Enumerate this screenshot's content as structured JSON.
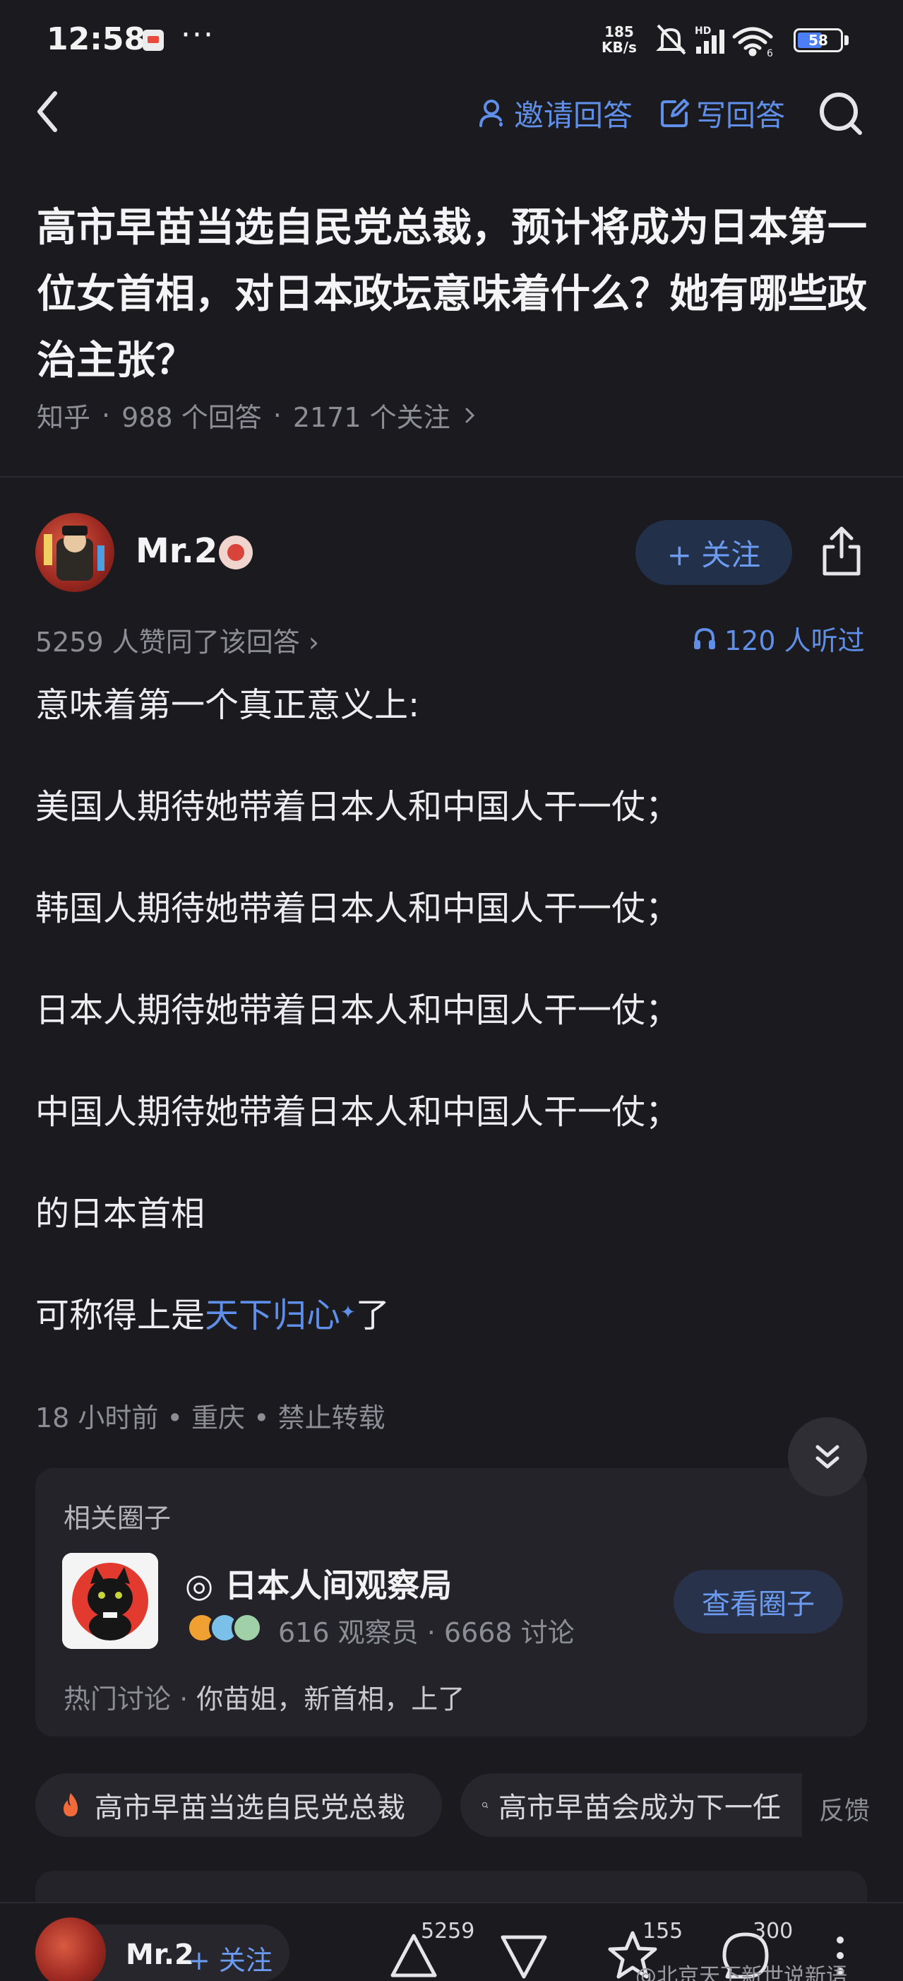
{
  "status_bar": {
    "time": "12:58",
    "more": "···",
    "net_speed_value": "185",
    "net_speed_unit": "KB/s",
    "network": "HD",
    "wifi_level": "6",
    "battery": "58",
    "battery_level": 0.58
  },
  "header": {
    "invite_label": "邀请回答",
    "write_label": "写回答"
  },
  "question": {
    "title": "高市早苗当选自民党总裁，预计将成为日本第一位女首相，对日本政坛意味着什么？她有哪些政治主张？",
    "source": "知乎",
    "answers": "988 个回答",
    "followers": "2171 个关注",
    "sep": "·"
  },
  "author": {
    "name": "Mr.2",
    "follow_label": "+ 关注",
    "upvotes": "5259 人赞同了该回答 ›",
    "listened": "120 人听过"
  },
  "answer": {
    "paragraphs": [
      "意味着第一个真正意义上:",
      "美国人期待她带着日本人和中国人干一仗；",
      "韩国人期待她带着日本人和中国人干一仗；",
      "日本人期待她带着日本人和中国人干一仗；",
      "中国人期待她带着日本人和中国人干一仗；",
      "的日本首相"
    ],
    "last_prefix": "可称得上是",
    "last_link": "天下归心",
    "last_star": "✦",
    "last_suffix": "了",
    "meta": "18 小时前 • 重庆 • 禁止转载"
  },
  "related_circle": {
    "section_title": "相关圈子",
    "name": "◎ 日本人间观察局",
    "members": "616 观察员",
    "discussions": "6668 讨论",
    "sep": "·",
    "view_label": "查看圈子",
    "hot_label": "热门讨论",
    "hot_topic": "你苗姐，新首相，上了"
  },
  "related_searches": {
    "items": [
      "高市早苗当选自民党总裁",
      "高市早苗会成为下一任"
    ],
    "feedback": "反馈"
  },
  "bottom_bar": {
    "author": "Mr.2",
    "follow": "+ 关注",
    "upvote_count": "5259",
    "favorite_count": "155",
    "comment_count": "300",
    "watermark": "@北京天下新世说新语"
  },
  "colors": {
    "background": "#1b1b1f",
    "accent_blue": "#5f8fe8",
    "muted_text": "#8d8d95",
    "hot_orange": "#f06a3a"
  }
}
